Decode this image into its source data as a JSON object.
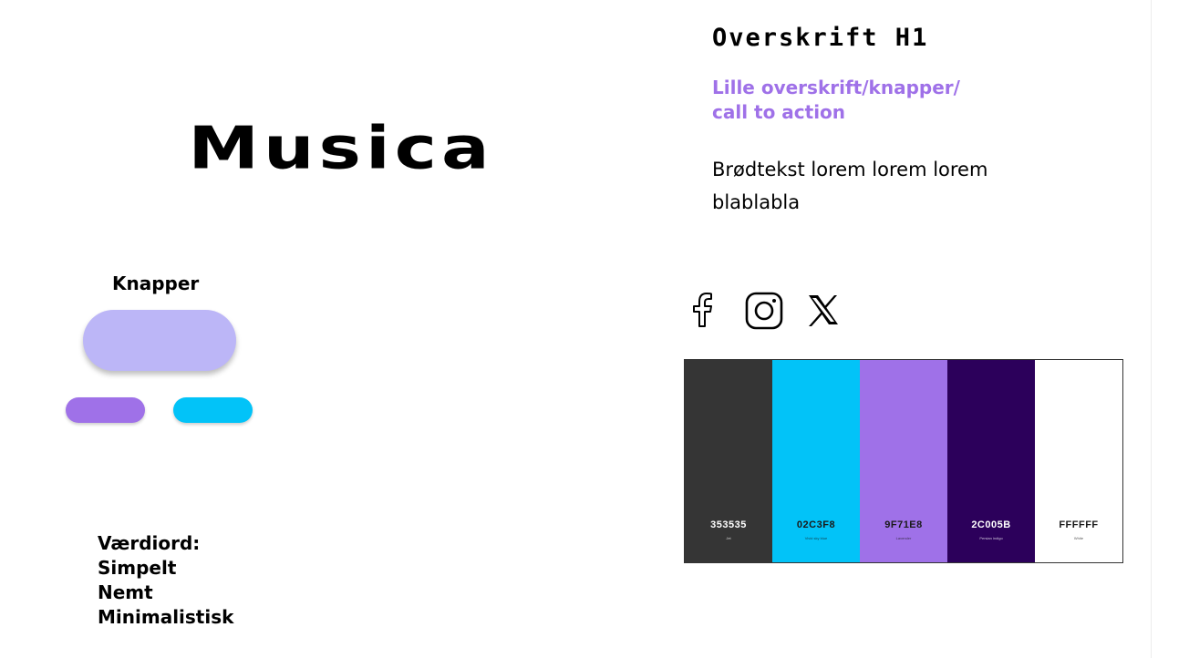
{
  "logo": {
    "text": "Musica"
  },
  "typography": {
    "h1": "Overskrift H1",
    "h2_line1": "Lille overskrift/knapper/",
    "h2_line2": "call to action",
    "body_line1": "Brødtekst lorem lorem lorem",
    "body_line2": "blablabla"
  },
  "buttons": {
    "title": "Knapper",
    "large_color": "#BCB6F7",
    "small_purple_color": "#9F71E8",
    "small_cyan_color": "#02C3F8"
  },
  "values": {
    "title": "Værdiord:",
    "items": [
      "Simpelt",
      "Nemt",
      "Minimalistisk"
    ]
  },
  "social_icons": [
    "facebook-icon",
    "instagram-icon",
    "x-icon"
  ],
  "palette": [
    {
      "hex": "353535",
      "name": "Jet",
      "color": "#353535",
      "text_color": "#ffffff"
    },
    {
      "hex": "02C3F8",
      "name": "Vivid sky blue",
      "color": "#02C3F8",
      "text_color": "#1a1a1a"
    },
    {
      "hex": "9F71E8",
      "name": "Lavender",
      "color": "#9F71E8",
      "text_color": "#1a1a1a"
    },
    {
      "hex": "2C005B",
      "name": "Persian indigo",
      "color": "#2C005B",
      "text_color": "#ffffff"
    },
    {
      "hex": "FFFFFF",
      "name": "White",
      "color": "#FFFFFF",
      "text_color": "#1a1a1a"
    }
  ]
}
